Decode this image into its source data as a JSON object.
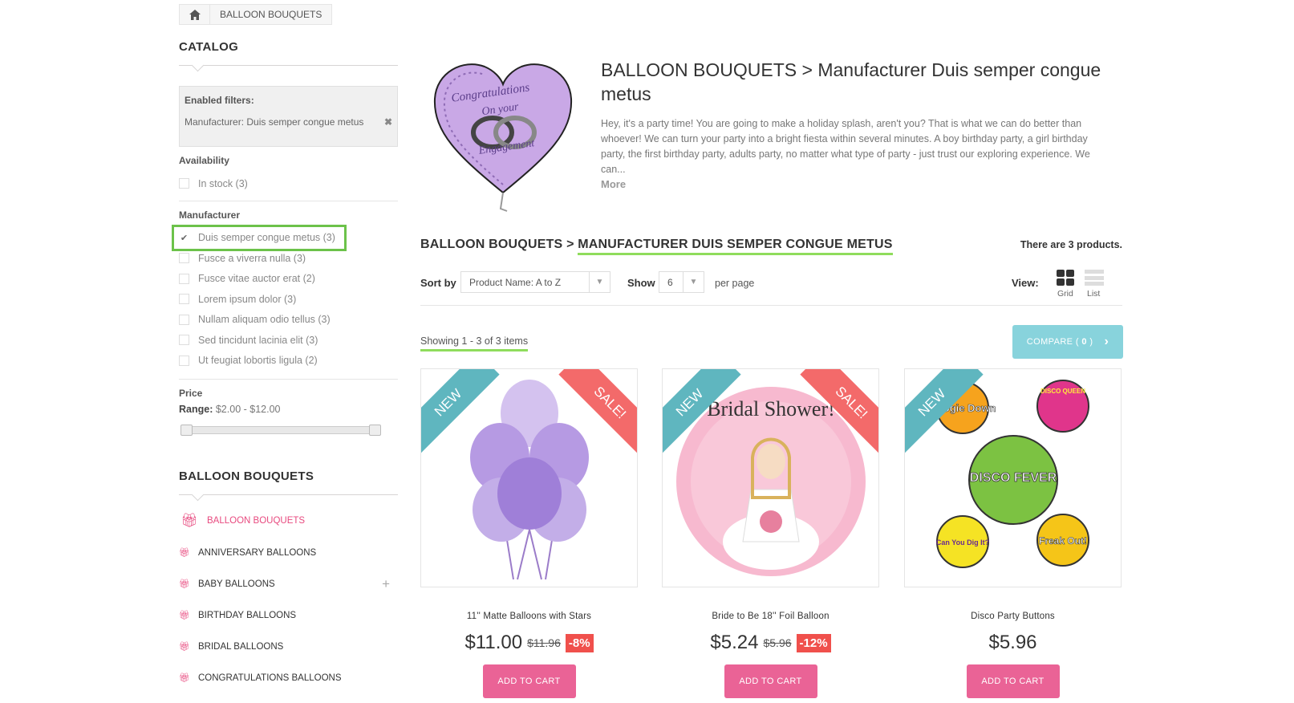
{
  "breadcrumb": {
    "home_icon": "home-icon",
    "current": "BALLOON BOUQUETS"
  },
  "catalog": {
    "title": "CATALOG",
    "enabled_filters": {
      "title": "Enabled filters:",
      "value": "Manufacturer: Duis semper congue metus"
    },
    "availability": {
      "label": "Availability",
      "items": [
        {
          "label": "In stock (3)"
        }
      ]
    },
    "manufacturer": {
      "label": "Manufacturer",
      "items": [
        {
          "label": "Duis semper congue metus (3)",
          "checked": true
        },
        {
          "label": "Fusce a viverra nulla (3)"
        },
        {
          "label": "Fusce vitae auctor erat (2)"
        },
        {
          "label": "Lorem ipsum dolor (3)"
        },
        {
          "label": "Nullam aliquam odio tellus (3)"
        },
        {
          "label": "Sed tincidunt lacinia elit (3)"
        },
        {
          "label": "Ut feugiat lobortis ligula (2)"
        }
      ]
    },
    "price": {
      "label": "Price",
      "range_label": "Range:",
      "range_value": "$2.00 - $12.00"
    }
  },
  "category_block": {
    "title": "BALLOON BOUQUETS",
    "items": [
      {
        "label": "BALLOON BOUQUETS"
      },
      {
        "label": "ANNIVERSARY BALLOONS"
      },
      {
        "label": "BABY BALLOONS"
      },
      {
        "label": "BIRTHDAY BALLOONS"
      },
      {
        "label": "BRIDAL BALLOONS"
      },
      {
        "label": "CONGRATULATIONS BALLOONS"
      }
    ]
  },
  "category": {
    "title": "BALLOON BOUQUETS > Manufacturer Duis semper congue metus",
    "image_text_1": "Congratulations",
    "image_text_2": "On your",
    "image_text_3": "Engagement",
    "description": "Hey, it's a party time! You are going to make a holiday splash, aren't you? That is what we can do better than whoever! We can turn your party into a bright fiesta within several minutes. A boy birthday party, a girl birthday party, the first birthday party, adults party, no matter what type of party - just trust our exploring experience. We can...",
    "more": "More"
  },
  "listing": {
    "heading_prefix": "BALLOON BOUQUETS > ",
    "heading_main": "MANUFACTURER DUIS SEMPER CONGUE METUS",
    "count": "There are 3 products.",
    "sort_label": "Sort by",
    "sort_value": "Product Name: A to Z",
    "show_label": "Show",
    "show_value": "6",
    "per_page": "per page",
    "view_label": "View:",
    "grid_label": "Grid",
    "list_label": "List",
    "showing": "Showing 1 - 3 of 3 items",
    "compare_label": "COMPARE (",
    "compare_count": "0",
    "compare_close": ")"
  },
  "products": [
    {
      "name": "11'' Matte Balloons with Stars",
      "price": "$11.00",
      "old_price": "$11.96",
      "discount": "-8%",
      "new": "NEW",
      "sale": "SALE!",
      "button": "ADD TO CART"
    },
    {
      "name": "Bride to Be 18'' Foil Balloon",
      "price": "$5.24",
      "old_price": "$5.96",
      "discount": "-12%",
      "new": "NEW",
      "sale": "SALE!",
      "button": "ADD TO CART",
      "image_text": "Bridal Shower!"
    },
    {
      "name": "Disco Party Buttons",
      "price": "$5.96",
      "new": "NEW",
      "button": "ADD TO CART",
      "badges": [
        "Boogie Down",
        "DISCO QUEEN",
        "DISCO FEVER",
        "Can You Dig It?",
        "Freak Out!"
      ]
    }
  ],
  "colors": {
    "accent_pink": "#ea6396",
    "sale_red": "#f36a6a",
    "new_teal": "#5fb6bf",
    "compare": "#88d3dc",
    "highlight_green": "#6cc24a"
  }
}
